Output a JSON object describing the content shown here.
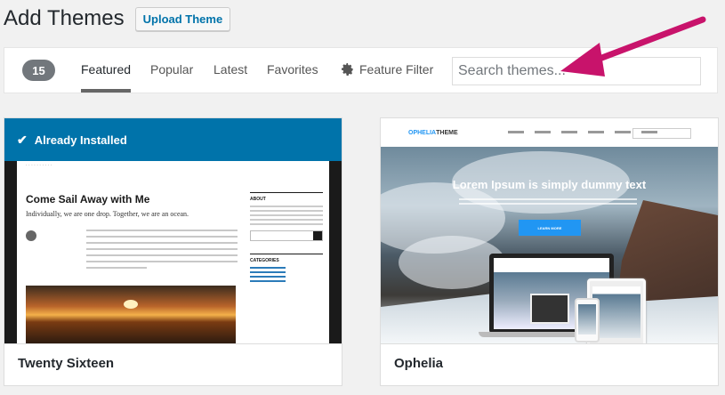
{
  "header": {
    "title": "Add Themes",
    "upload_label": "Upload Theme"
  },
  "filter": {
    "count": "15",
    "tabs": [
      {
        "label": "Featured",
        "active": true
      },
      {
        "label": "Popular",
        "active": false
      },
      {
        "label": "Latest",
        "active": false
      },
      {
        "label": "Favorites",
        "active": false
      }
    ],
    "feature_filter_label": "Feature Filter",
    "search_placeholder": "Search themes..."
  },
  "themes": [
    {
      "name": "Twenty Sixteen",
      "installed_label": "Already Installed",
      "preview": {
        "post_title": "Come Sail Away with Me",
        "post_subtitle": "Individually, we are one drop. Together, we are an ocean.",
        "sidebar_heading_1": "ABOUT",
        "sidebar_heading_2": "CATEGORIES"
      }
    },
    {
      "name": "Ophelia",
      "preview": {
        "logo_prefix": "OPHELIA",
        "logo_suffix": "THEME",
        "headline": "Lorem Ipsum is simply dummy text",
        "button_label": "LEARN MORE"
      }
    }
  ],
  "colors": {
    "accent": "#0073aa",
    "annotation_arrow": "#c8136b",
    "count_badge": "#72777c"
  }
}
